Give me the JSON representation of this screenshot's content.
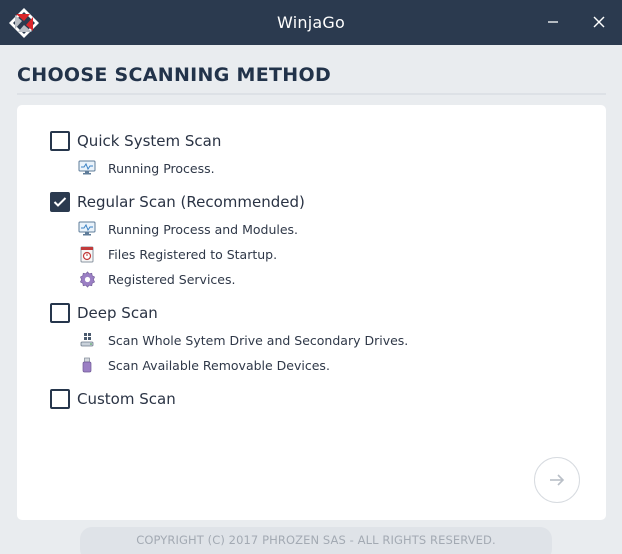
{
  "window": {
    "title": "WinjaGo"
  },
  "heading": "CHOOSE SCANNING METHOD",
  "options": [
    {
      "label": "Quick System Scan",
      "checked": false,
      "items": [
        {
          "icon": "monitor-icon",
          "label": "Running Process."
        }
      ]
    },
    {
      "label": "Regular Scan (Recommended)",
      "checked": true,
      "items": [
        {
          "icon": "monitor-icon",
          "label": "Running Process and Modules."
        },
        {
          "icon": "startup-icon",
          "label": "Files Registered to Startup."
        },
        {
          "icon": "gear-icon",
          "label": "Registered Services."
        }
      ]
    },
    {
      "label": "Deep Scan",
      "checked": false,
      "items": [
        {
          "icon": "drive-icon",
          "label": "Scan Whole Sytem Drive and Secondary Drives."
        },
        {
          "icon": "usb-icon",
          "label": "Scan Available Removable Devices."
        }
      ]
    },
    {
      "label": "Custom Scan",
      "checked": false,
      "items": []
    }
  ],
  "footer": {
    "copyright": "COPYRIGHT (C) 2017 PHROZEN SAS - ALL RIGHTS RESERVED."
  },
  "colors": {
    "titlebar": "#2b3a4f",
    "accent": "#2b3a4f",
    "background": "#e9ecef"
  }
}
